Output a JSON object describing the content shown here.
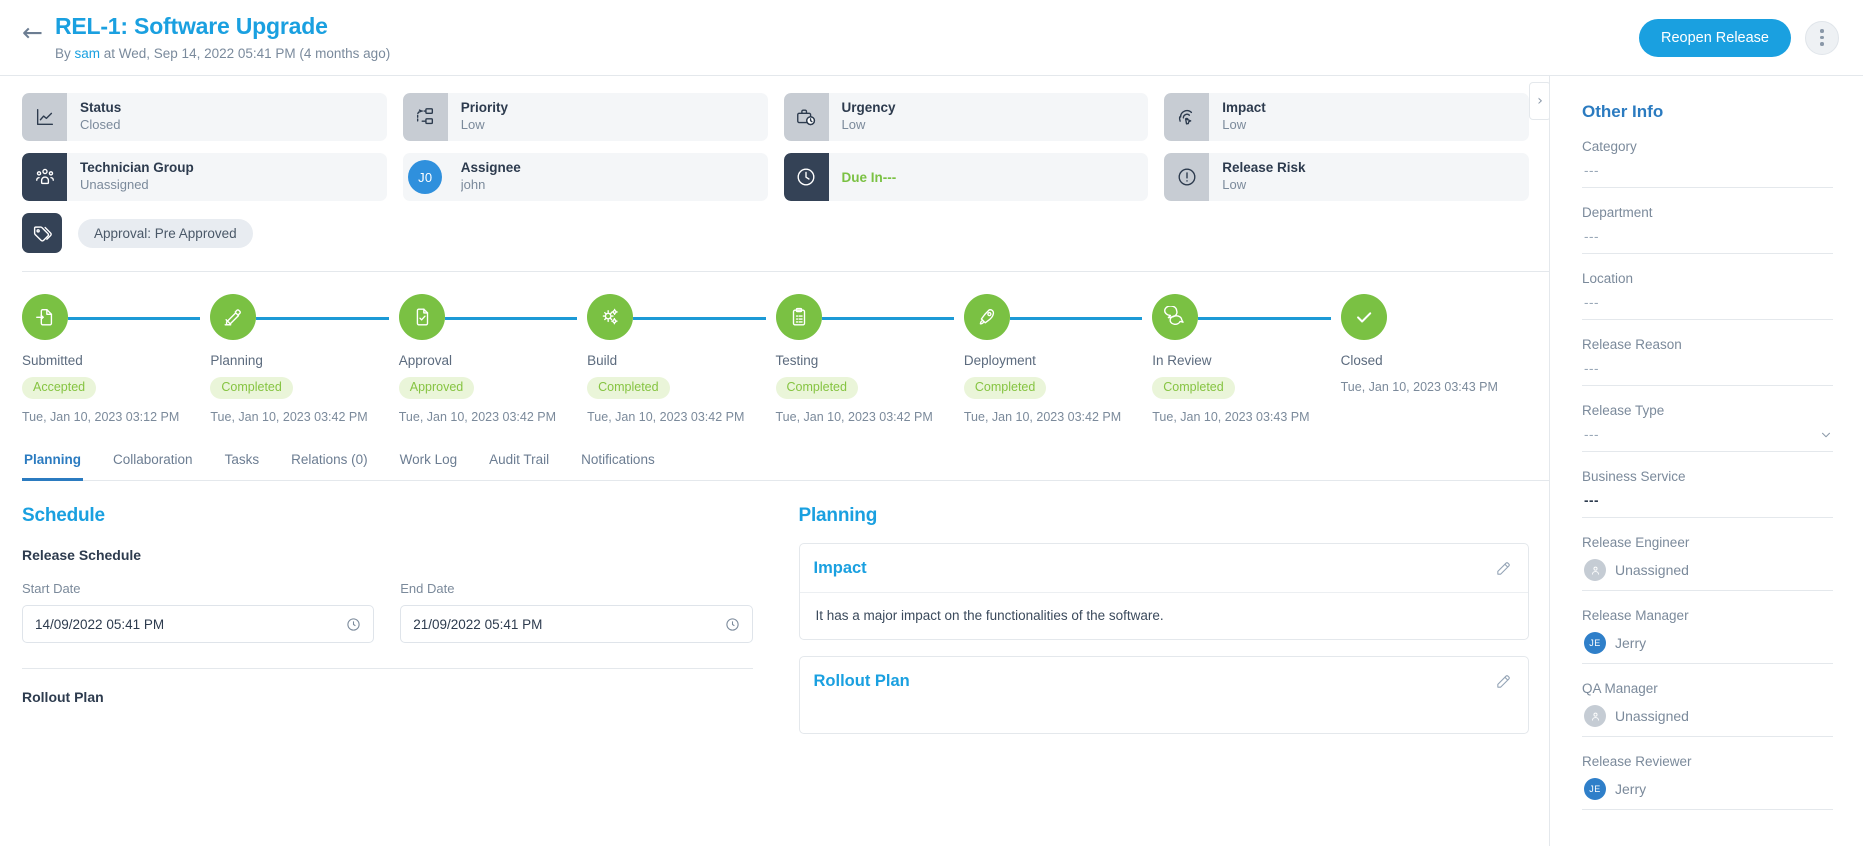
{
  "header": {
    "back_icon": "arrow-left-icon",
    "title": "REL-1: Software Upgrade",
    "by_prefix": "By",
    "user": "sam",
    "meta": "at Wed, Sep 14, 2022 05:41 PM (4 months ago)",
    "primary_button": "Reopen Release",
    "more_icon": "kebab-menu-icon",
    "accent_color": "#1aa0e0"
  },
  "cards": {
    "next_icon": "chevron-right-icon",
    "row1": [
      {
        "icon": "chart-line-icon",
        "label": "Status",
        "value": "Closed",
        "box": "gray"
      },
      {
        "icon": "priority-flow-icon",
        "label": "Priority",
        "value": "Low",
        "box": "gray"
      },
      {
        "icon": "briefcase-clock-icon",
        "label": "Urgency",
        "value": "Low",
        "box": "gray"
      },
      {
        "icon": "fingerprint-touch-icon",
        "label": "Impact",
        "value": "Low",
        "box": "gray"
      }
    ],
    "row2": [
      {
        "icon": "users-group-icon",
        "label": "Technician Group",
        "value": "Unassigned",
        "box": "dark"
      },
      {
        "icon": "avatar-icon",
        "label": "Assignee",
        "value": "john",
        "box": "avatar",
        "initials": "J0"
      },
      {
        "icon": "clock-icon",
        "label": "Due In---",
        "box": "dark",
        "type": "duein",
        "due_color": "#7ac143"
      },
      {
        "icon": "exclamation-circle-icon",
        "label": "Release Risk",
        "value": "Low",
        "box": "gray"
      }
    ],
    "tag": {
      "icon": "tags-icon",
      "chip": "Approval: Pre Approved"
    }
  },
  "stepper": [
    {
      "icon": "submit-doc-icon",
      "name": "Submitted",
      "badge": "Accepted",
      "date": "Tue, Jan 10, 2023 03:12 PM"
    },
    {
      "icon": "planning-pencil-icon",
      "name": "Planning",
      "badge": "Completed",
      "date": "Tue, Jan 10, 2023 03:42 PM"
    },
    {
      "icon": "doc-check-icon",
      "name": "Approval",
      "badge": "Approved",
      "date": "Tue, Jan 10, 2023 03:42 PM"
    },
    {
      "icon": "gears-icon",
      "name": "Build",
      "badge": "Completed",
      "date": "Tue, Jan 10, 2023 03:42 PM"
    },
    {
      "icon": "clipboard-check-icon",
      "name": "Testing",
      "badge": "Completed",
      "date": "Tue, Jan 10, 2023 03:42 PM"
    },
    {
      "icon": "rocket-icon",
      "name": "Deployment",
      "badge": "Completed",
      "date": "Tue, Jan 10, 2023 03:42 PM"
    },
    {
      "icon": "chat-bubbles-icon",
      "name": "In Review",
      "badge": "Completed",
      "date": "Tue, Jan 10, 2023 03:43 PM"
    },
    {
      "icon": "check-icon",
      "name": "Closed",
      "badge": "",
      "date": "Tue, Jan 10, 2023 03:43 PM"
    }
  ],
  "tabs": [
    {
      "label": "Planning",
      "active": true
    },
    {
      "label": "Collaboration",
      "active": false
    },
    {
      "label": "Tasks",
      "active": false
    },
    {
      "label": "Relations (0)",
      "active": false
    },
    {
      "label": "Work Log",
      "active": false
    },
    {
      "label": "Audit Trail",
      "active": false
    },
    {
      "label": "Notifications",
      "active": false
    }
  ],
  "schedule": {
    "heading": "Schedule",
    "sub_heading": "Release Schedule",
    "start_label": "Start Date",
    "start_value": "14/09/2022 05:41 PM",
    "end_label": "End Date",
    "end_value": "21/09/2022 05:41 PM",
    "clock_icon": "clock-icon",
    "rollout_heading": "Rollout Plan"
  },
  "planning": {
    "heading": "Planning",
    "edit_icon": "pencil-icon",
    "blocks": [
      {
        "title": "Impact",
        "body": "It has a major impact on the functionalities of the software."
      },
      {
        "title": "Rollout Plan",
        "body": ""
      }
    ]
  },
  "side": {
    "heading": "Other Info",
    "chevron_icon": "chevron-down-icon",
    "fields": [
      {
        "label": "Category",
        "value": "---",
        "type": "text"
      },
      {
        "label": "Department",
        "value": "---",
        "type": "text"
      },
      {
        "label": "Location",
        "value": "---",
        "type": "text"
      },
      {
        "label": "Release Reason",
        "value": "---",
        "type": "text"
      },
      {
        "label": "Release Type",
        "value": "---",
        "type": "select"
      },
      {
        "label": "Business Service",
        "value": "---",
        "type": "text-dark"
      },
      {
        "label": "Release Engineer",
        "value": "Unassigned",
        "type": "person",
        "initials": "",
        "avatar": "gray"
      },
      {
        "label": "Release Manager",
        "value": "Jerry",
        "type": "person",
        "initials": "JE",
        "avatar": "blue"
      },
      {
        "label": "QA Manager",
        "value": "Unassigned",
        "type": "person",
        "initials": "",
        "avatar": "gray"
      },
      {
        "label": "Release Reviewer",
        "value": "Jerry",
        "type": "person",
        "initials": "JE",
        "avatar": "blue"
      }
    ]
  }
}
